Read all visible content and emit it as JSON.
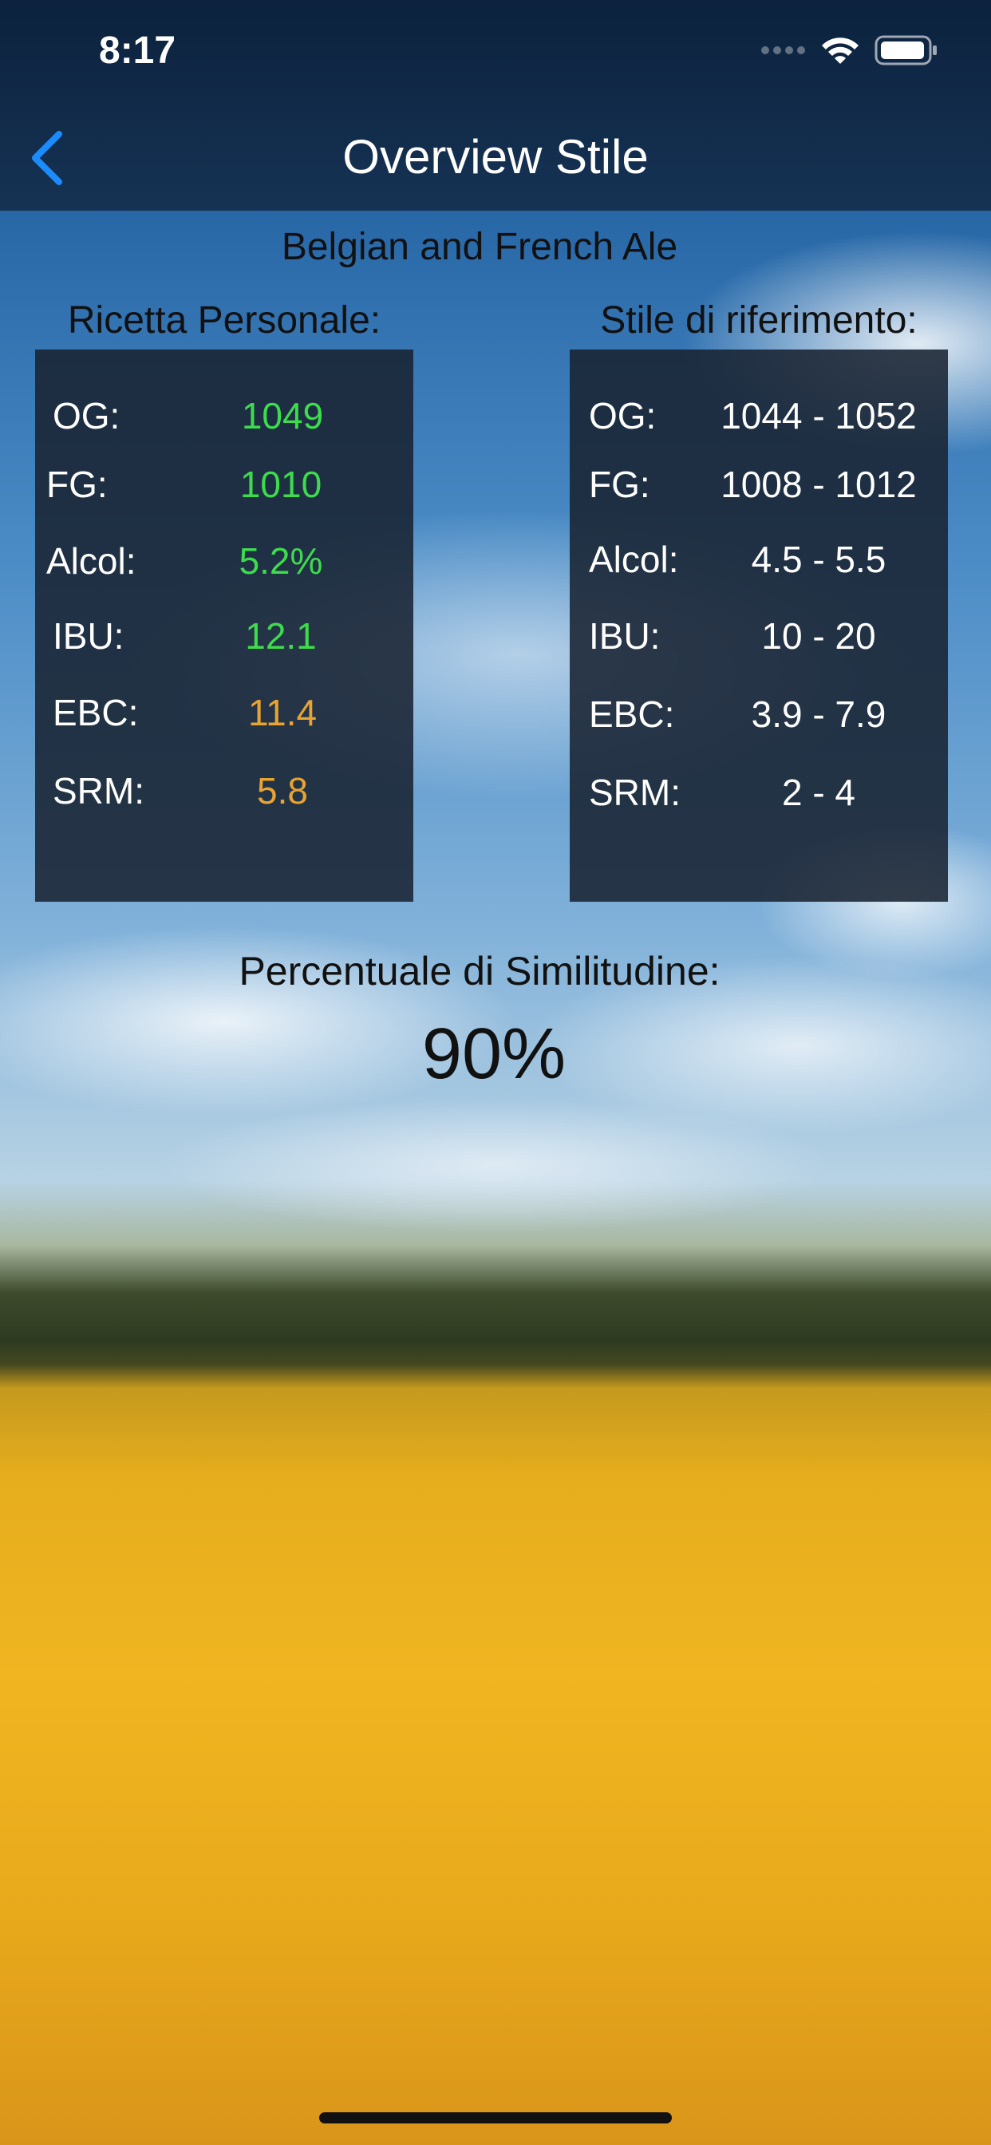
{
  "status_bar": {
    "time": "8:17",
    "icons": [
      "signal-dots-icon",
      "wifi-icon",
      "battery-icon"
    ]
  },
  "nav": {
    "back_icon": "chevron-left-icon",
    "title": "Overview Stile",
    "accent_color": "#1a8cff"
  },
  "style_name": "Belgian and French Ale",
  "personal": {
    "heading": "Ricetta Personale:",
    "rows": [
      {
        "label": "OG:",
        "value": "1049",
        "color": "#3ddc4c"
      },
      {
        "label": "FG:",
        "value": "1010",
        "color": "#3ddc4c"
      },
      {
        "label": "Alcol:",
        "value": "5.2%",
        "color": "#3ddc4c"
      },
      {
        "label": "IBU:",
        "value": "12.1",
        "color": "#3ddc4c"
      },
      {
        "label": "EBC:",
        "value": "11.4",
        "color": "#e8a431"
      },
      {
        "label": "SRM:",
        "value": "5.8",
        "color": "#e8a431"
      }
    ]
  },
  "reference": {
    "heading": "Stile di riferimento:",
    "rows": [
      {
        "label": "OG:",
        "range": "1044 - 1052"
      },
      {
        "label": "FG:",
        "range": "1008 - 1012"
      },
      {
        "label": "Alcol:",
        "range": "4.5 - 5.5"
      },
      {
        "label": "IBU:",
        "range": "10 - 20"
      },
      {
        "label": "EBC:",
        "range": "3.9 - 7.9"
      },
      {
        "label": "SRM:",
        "range": "2 - 4"
      }
    ]
  },
  "similarity": {
    "label": "Percentuale di Similitudine:",
    "value": "90%"
  }
}
